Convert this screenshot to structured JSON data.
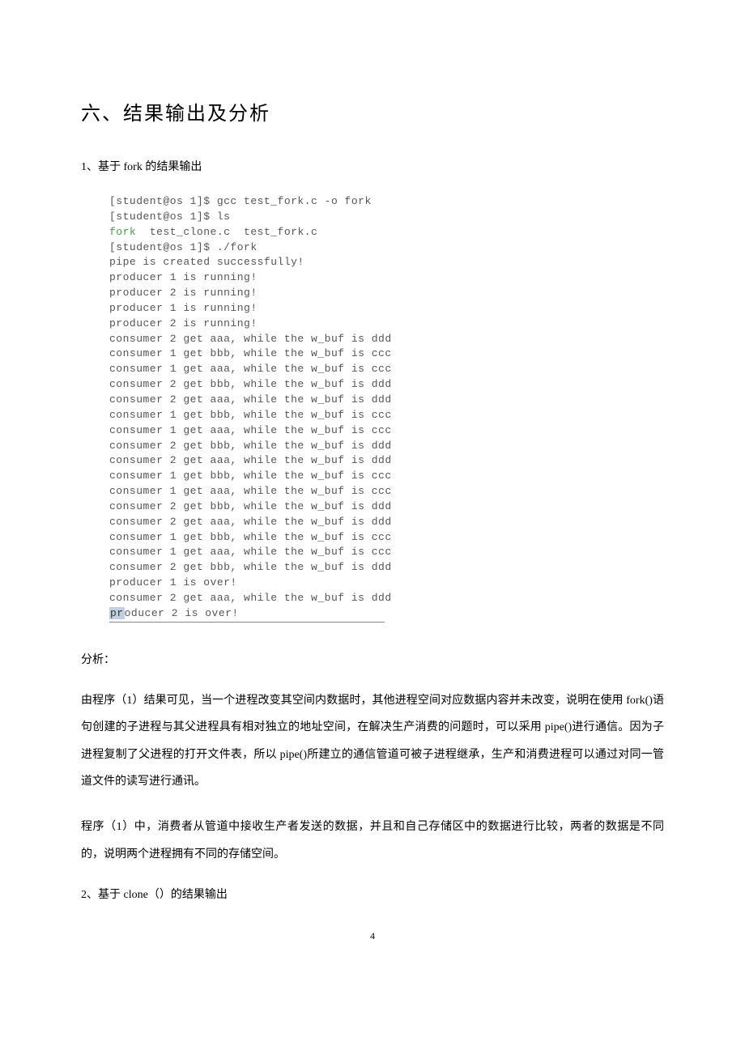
{
  "section_title": "六、结果输出及分析",
  "sub_heading_1": "1、基于 fork 的结果输出",
  "terminal": {
    "line1": "[student@os 1]$ gcc test_fork.c -o fork",
    "line2": "[student@os 1]$ ls",
    "line3_green": "fork",
    "line3_rest": "  test_clone.c  test_fork.c",
    "line4": "[student@os 1]$ ./fork",
    "line5": "pipe is created successfully!",
    "line6": "producer 1 is running!",
    "line7": "producer 2 is running!",
    "line8": "producer 1 is running!",
    "line9": "producer 2 is running!",
    "line10": "consumer 2 get aaa, while the w_buf is ddd",
    "line11": "consumer 1 get bbb, while the w_buf is ccc",
    "line12": "consumer 1 get aaa, while the w_buf is ccc",
    "line13": "consumer 2 get bbb, while the w_buf is ddd",
    "line14": "consumer 2 get aaa, while the w_buf is ddd",
    "line15": "consumer 1 get bbb, while the w_buf is ccc",
    "line16": "consumer 1 get aaa, while the w_buf is ccc",
    "line17": "consumer 2 get bbb, while the w_buf is ddd",
    "line18": "consumer 2 get aaa, while the w_buf is ddd",
    "line19": "consumer 1 get bbb, while the w_buf is ccc",
    "line20": "consumer 1 get aaa, while the w_buf is ccc",
    "line21": "consumer 2 get bbb, while the w_buf is ddd",
    "line22": "consumer 2 get aaa, while the w_buf is ddd",
    "line23": "consumer 1 get bbb, while the w_buf is ccc",
    "line24": "consumer 1 get aaa, while the w_buf is ccc",
    "line25": "consumer 2 get bbb, while the w_buf is ddd",
    "line26": "producer 1 is over!",
    "line27": "consumer 2 get aaa, while the w_buf is ddd",
    "line28_sel": "pr",
    "line28_rest": "oducer 2 is over!"
  },
  "analysis_label": "分析：",
  "para1": "由程序（1）结果可见，当一个进程改变其空间内数据时，其他进程空间对应数据内容并未改变，说明在使用 fork()语句创建的子进程与其父进程具有相对独立的地址空间，在解决生产消费的问题时，可以采用 pipe()进行通信。因为子进程复制了父进程的打开文件表，所以 pipe()所建立的通信管道可被子进程继承，生产和消费进程可以通过对同一管道文件的读写进行通讯。",
  "para2": "程序（1）中，消费者从管道中接收生产者发送的数据，并且和自己存储区中的数据进行比较，两者的数据是不同的，说明两个进程拥有不同的存储空间。",
  "sub_heading_2": "2、基于 clone（）的结果输出",
  "page_number": "4"
}
